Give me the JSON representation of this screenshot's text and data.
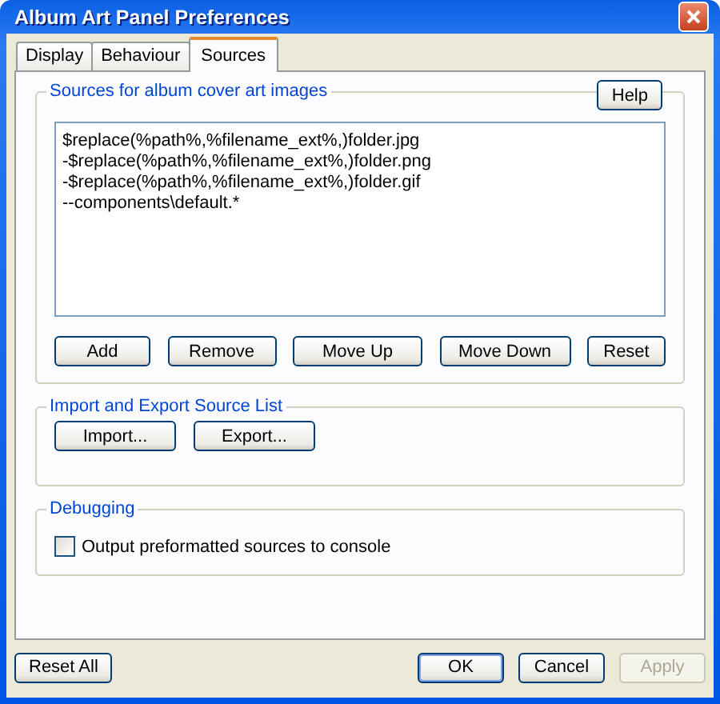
{
  "window": {
    "title": "Album Art Panel Preferences"
  },
  "tabs": [
    {
      "label": "Display",
      "selected": false
    },
    {
      "label": "Behaviour",
      "selected": false
    },
    {
      "label": "Sources",
      "selected": true
    }
  ],
  "sources_group": {
    "title": "Sources for album cover art images",
    "help_button": "Help",
    "lines": [
      "$replace(%path%,%filename_ext%,)folder.jpg",
      "-$replace(%path%,%filename_ext%,)folder.png",
      "-$replace(%path%,%filename_ext%,)folder.gif",
      "--components\\default.*"
    ],
    "buttons": [
      "Add",
      "Remove",
      "Move Up",
      "Move Down",
      "Reset"
    ]
  },
  "import_export_group": {
    "title": "Import and Export Source List",
    "buttons": [
      "Import...",
      "Export..."
    ]
  },
  "debugging_group": {
    "title": "Debugging",
    "checkbox": {
      "label": "Output preformatted sources to console",
      "checked": false
    }
  },
  "footer": {
    "left_button": {
      "label": "Reset All",
      "disabled": false
    },
    "right_buttons": [
      {
        "label": "OK",
        "disabled": false,
        "default": true
      },
      {
        "label": "Cancel",
        "disabled": false,
        "default": false
      },
      {
        "label": "Apply",
        "disabled": true,
        "default": false
      }
    ]
  }
}
